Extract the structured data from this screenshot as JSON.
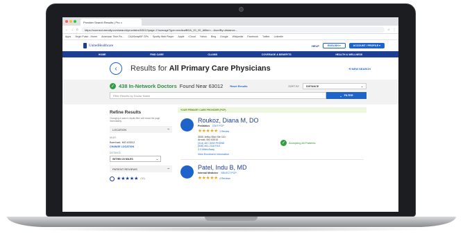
{
  "browser": {
    "tab_title": "Provider Search Results | Pro",
    "url": "https://connect.werally.com/search/providers/63012/page-1?averageType=medicalBDA_20_20_&filter=...&sortBy=distance...",
    "bookmarks": [
      "Apps",
      "Virgin Pulse - Home",
      "American Time Pa...",
      "CAASmapBF GPs",
      "Spotify Web Player",
      "Apple",
      "iCloud",
      "Yahoo",
      "Bing",
      "Google",
      "Wikipedia",
      "Facebook",
      "Twitter",
      "LinkedIn"
    ]
  },
  "site": {
    "logo_text": "UnitedHealthcare",
    "help_label": "HELP",
    "language_label": "ENGLISH",
    "account_label": "ACCOUNT / PROFILE",
    "nav": [
      "HOME",
      "FIND CARE",
      "CLAIMS",
      "COVERAGE & BENEFITS",
      "HEALTH & WELLNESS"
    ]
  },
  "page": {
    "back_icon": "chevron-left-icon",
    "title_prefix": "Results for ",
    "title_bold": "All Primary Care Physicians",
    "new_search": "NEW SEARCH",
    "count_bold": "438 In-Network Doctors",
    "count_rest": " Found Near 63012",
    "reset": "Reset Results",
    "sort_label": "SORT BY",
    "sort_value": "DISTANCE",
    "filter_placeholder": "Filter Results by Doctor Name",
    "filter_button": "FILTER"
  },
  "refine": {
    "heading": "Refine Results",
    "subtext": "Changing a search results filter will reload the page immediately.",
    "location_header": "LOCATION",
    "near_label": "NEAR:",
    "near_value": "Barnhart, MO 63012",
    "change_location": "CHANGE LOCATION",
    "distance_label": "DISTANCE",
    "distance_value": "WITHIN 20 MILES",
    "reviews_header": "PATIENT REVIEWS",
    "stars_count": "(90)"
  },
  "results": {
    "pcp_banner": "YOUR PRIMARY CARE PROVIDER (PCP)",
    "doctors": [
      {
        "name": "Roukoz, Diana M, DO",
        "specialty": "Pediatrics",
        "pcp_action": "EDIT PCP",
        "reviews": "1 Review",
        "address1": "3530 Jeffco Blvd Ste 110",
        "address2": "Arnold, MO 63010",
        "phone1": "(314) 467-3000 PHONE",
        "phone2": "(636) 461-2116 FAX",
        "miles": "3.3 Miles Away",
        "more": "View Enrollment Information",
        "accepting": "Accepting All Patients"
      },
      {
        "name": "Patel, Indu B, MD",
        "specialty": "Internal Medicine",
        "pcp_action": "SELECT PCP",
        "reviews": "4 Reviews"
      }
    ]
  }
}
